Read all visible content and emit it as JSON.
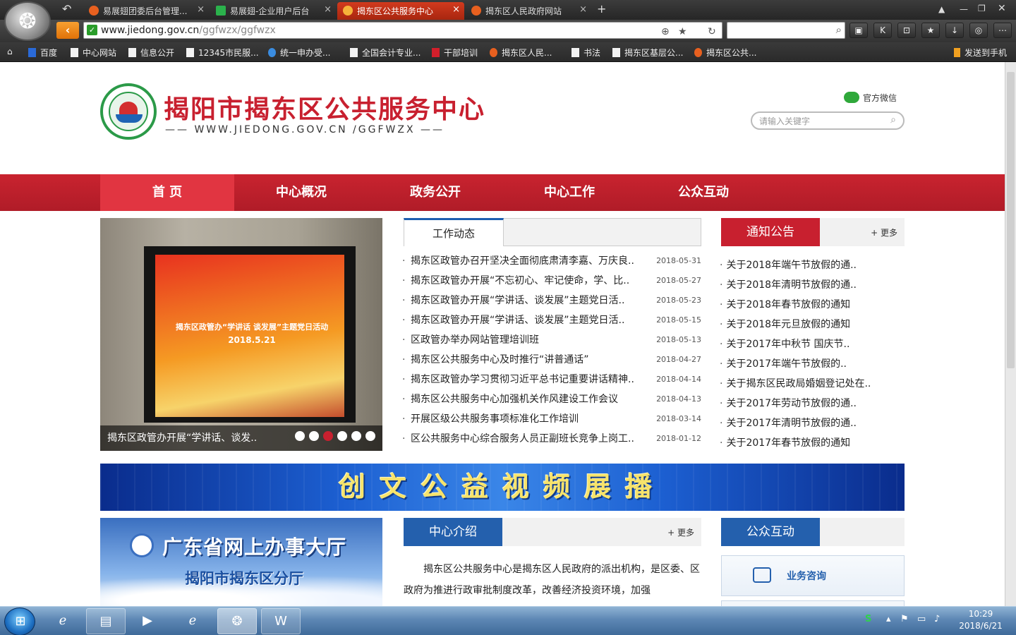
{
  "browser": {
    "tabs": [
      {
        "label": "易展翅团委后台管理...",
        "color": "#e8601f"
      },
      {
        "label": "易展翅-企业用户后台",
        "color": "#2bb24c"
      },
      {
        "label": "揭东区公共服务中心",
        "color": "#e8601f"
      },
      {
        "label": "揭东区人民政府网站",
        "color": "#e8601f"
      }
    ],
    "new_tab": "+",
    "url_host": "www.jiedong.gov.cn",
    "url_path": "/ggfwzx/ggfwzx",
    "bookmarks": [
      "百度",
      "中心网站",
      "信息公开",
      "12345市民服...",
      "统一申办受...",
      "全国会计专业...",
      "干部培训",
      "揭东区人民...",
      "书法",
      "揭东区基层公...",
      "揭东区公共..."
    ],
    "send_to_phone": "发送到手机"
  },
  "site": {
    "title": "揭阳市揭东区公共服务中心",
    "url": "—— WWW.JIEDONG.GOV.CN /GGFWZX ——",
    "wechat": "官方微信",
    "search_placeholder": "请输入关键字",
    "nav": [
      "首 页",
      "中心概况",
      "政务公开",
      "中心工作",
      "公众互动"
    ],
    "slider": {
      "caption": "揭东区政管办开展“学讲话、谈发..",
      "slide_text_1": "揭东区政管办“学讲话 谈发展”主题党日活动",
      "slide_text_2": "2018.5.21",
      "active_dot": 2,
      "dot_count": 6
    },
    "work_news": {
      "tab": "工作动态",
      "items": [
        {
          "title": "揭东区政管办召开坚决全面彻底肃清李嘉、万庆良..",
          "date": "2018-05-31"
        },
        {
          "title": "揭东区政管办开展“不忘初心、牢记使命，学、比..",
          "date": "2018-05-27"
        },
        {
          "title": "揭东区政管办开展“学讲话、谈发展”主题党日活..",
          "date": "2018-05-23"
        },
        {
          "title": "揭东区政管办开展“学讲话、谈发展”主题党日活..",
          "date": "2018-05-15"
        },
        {
          "title": "区政管办举办网站管理培训班",
          "date": "2018-05-13"
        },
        {
          "title": "揭东区公共服务中心及时推行“讲普通话”",
          "date": "2018-04-27"
        },
        {
          "title": "揭东区政管办学习贯彻习近平总书记重要讲话精神..",
          "date": "2018-04-14"
        },
        {
          "title": "揭东区公共服务中心加强机关作风建设工作会议",
          "date": "2018-04-13"
        },
        {
          "title": "开展区级公共服务事项标准化工作培训",
          "date": "2018-03-14"
        },
        {
          "title": "区公共服务中心综合服务人员正副班长竞争上岗工..",
          "date": "2018-01-12"
        }
      ]
    },
    "notices": {
      "tab": "通知公告",
      "more": "+ 更多",
      "items": [
        "关于2018年端午节放假的通..",
        "关于2018年清明节放假的通..",
        "关于2018年春节放假的通知",
        "关于2018年元旦放假的通知",
        "关于2017年中秋节 国庆节..",
        "关于2017年端午节放假的..",
        "关于揭东区民政局婚姻登记处在..",
        "关于2017年劳动节放假的通..",
        "关于2017年清明节放假的通..",
        "关于2017年春节放假的通知"
      ]
    },
    "banner": "创文公益视频展播",
    "gd_portal": {
      "line1": "广东省网上办事大厅",
      "line2": "揭阳市揭东区分厅"
    },
    "intro": {
      "tab": "中心介绍",
      "more": "+ 更多",
      "text": "揭东区公共服务中心是揭东区人民政府的派出机构，是区委、区政府为推进行政审批制度改革，改善经济投资环境，加强"
    },
    "public": {
      "tab": "公众互动",
      "consult": "业务咨询"
    }
  },
  "taskbar": {
    "time": "10:29",
    "date": "2018/6/21"
  },
  "colors": {
    "brand_red": "#c8202f",
    "brand_blue": "#2460ad",
    "active_tab": "#d23a1e"
  }
}
